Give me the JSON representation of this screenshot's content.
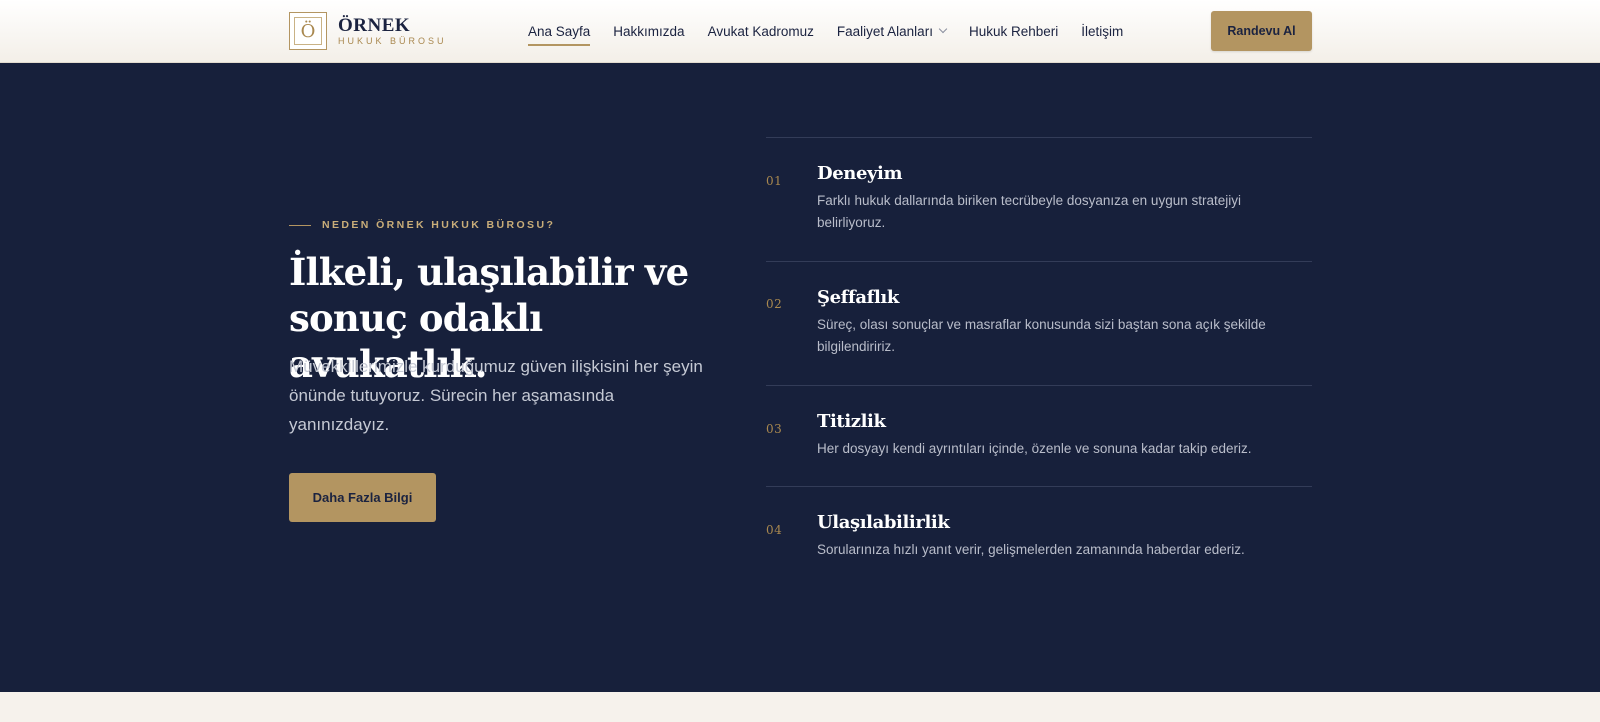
{
  "header": {
    "logo_letter": "Ö",
    "logo_name": "ÖRNEK",
    "logo_sub": "HUKUK BÜROSU",
    "nav": [
      {
        "label": "Ana Sayfa",
        "active": true
      },
      {
        "label": "Hakkımızda",
        "active": false
      },
      {
        "label": "Avukat Kadromuz",
        "active": false
      },
      {
        "label": "Faaliyet Alanları",
        "active": false,
        "dropdown": true
      },
      {
        "label": "Hukuk Rehberi",
        "active": false
      },
      {
        "label": "İletişim",
        "active": false
      }
    ],
    "cta_label": "Randevu Al"
  },
  "hero": {
    "eyebrow": "NEDEN ÖRNEK HUKUK BÜROSU?",
    "headline": "İlkeli, ulaşılabilir ve sonuç odaklı avukatlık.",
    "lead": "Müvekkillerimizle kurduğumuz güven ilişkisini her şeyin önünde tutuyoruz. Sürecin her aşamasında yanınızdayız.",
    "button_label": "Daha Fazla Bilgi"
  },
  "features": [
    {
      "num": "01",
      "title": "Deneyim",
      "text": "Farklı hukuk dallarında biriken tecrübeyle dosyanıza en uygun stratejiyi belirliyoruz."
    },
    {
      "num": "02",
      "title": "Şeffaflık",
      "text": "Süreç, olası sonuçlar ve masraflar konusunda sizi baştan sona açık şekilde bilgilendiririz."
    },
    {
      "num": "03",
      "title": "Titizlik",
      "text": "Her dosyayı kendi ayrıntıları içinde, özenle ve sonuna kadar takip ederiz."
    },
    {
      "num": "04",
      "title": "Ulaşılabilirlik",
      "text": "Sorularınıza hızlı yanıt verir, gelişmelerden zamanında haberdar ederiz."
    }
  ],
  "colors": {
    "navy": "#17203b",
    "gold": "#b39561",
    "cream": "#f6f2ec"
  }
}
